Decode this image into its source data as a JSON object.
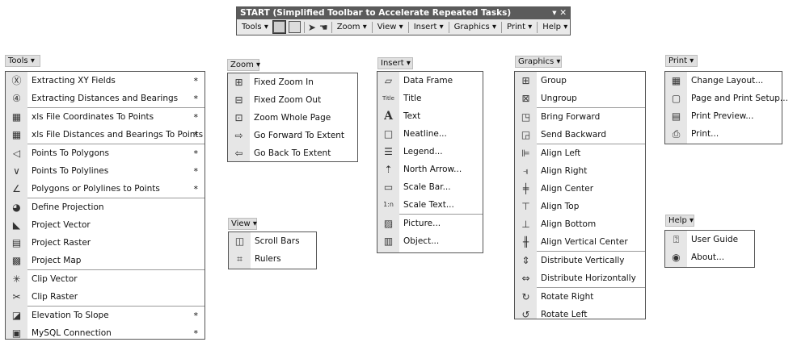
{
  "toolbar": {
    "title": "START (Simplified Toolbar to Accelerate Repeated Tasks)",
    "title_controls": "▾ ✕",
    "tools_label": "Tools",
    "zoom_label": "Zoom",
    "view_label": "View",
    "insert_label": "Insert",
    "graphics_label": "Graphics",
    "print_label": "Print",
    "help_label": "Help"
  },
  "tools_menu": {
    "header": "Tools",
    "items": [
      {
        "label": "Extracting  XY Fields",
        "star": "*",
        "icon": "xy-circle-icon"
      },
      {
        "label": "Extracting Distances and Bearings",
        "star": "*",
        "icon": "angle-45-icon"
      },
      {
        "label": "xls File Coordinates To Points",
        "star": "*",
        "icon": "xls-icon"
      },
      {
        "label": "xls File Distances and Bearings To Points",
        "star": "*",
        "icon": "xls-icon"
      },
      {
        "label": "Points To Polygons",
        "star": "*",
        "icon": "polygon-icon"
      },
      {
        "label": "Points To Polylines",
        "star": "*",
        "icon": "polyline-icon"
      },
      {
        "label": "Polygons or Polylines to Points",
        "star": "*",
        "icon": "points-icon"
      },
      {
        "label": "Define Projection",
        "star": "",
        "icon": "globe-icon"
      },
      {
        "label": "Project Vector",
        "star": "",
        "icon": "project-vector-icon"
      },
      {
        "label": "Project Raster",
        "star": "",
        "icon": "raster-grid-icon"
      },
      {
        "label": "Project Map",
        "star": "",
        "icon": "map-icon"
      },
      {
        "label": "Clip Vector",
        "star": "",
        "icon": "clip-vector-icon"
      },
      {
        "label": "Clip Raster",
        "star": "",
        "icon": "clip-raster-icon"
      },
      {
        "label": "Elevation To Slope",
        "star": "*",
        "icon": "slope-icon"
      },
      {
        "label": "MySQL Connection",
        "star": "*",
        "icon": "database-icon"
      }
    ]
  },
  "zoom_menu": {
    "header": "Zoom",
    "items": [
      {
        "label": "Fixed Zoom In",
        "icon": "zoom-in-icon"
      },
      {
        "label": "Fixed Zoom Out",
        "icon": "zoom-out-icon"
      },
      {
        "label": "Zoom Whole Page",
        "icon": "whole-page-icon"
      },
      {
        "label": "Go Forward To Extent",
        "icon": "forward-extent-icon"
      },
      {
        "label": "Go Back To Extent",
        "icon": "back-extent-icon"
      }
    ]
  },
  "view_menu": {
    "header": "View",
    "items": [
      {
        "label": "Scroll Bars",
        "icon": "scrollbars-icon"
      },
      {
        "label": "Rulers",
        "icon": "rulers-icon"
      }
    ]
  },
  "insert_menu": {
    "header": "Insert",
    "items": [
      {
        "label": "Data Frame",
        "icon": "data-frame-icon"
      },
      {
        "label": "Title",
        "icon": "title-icon"
      },
      {
        "label": "Text",
        "icon": "text-icon"
      },
      {
        "label": "Neatline...",
        "icon": "neatline-icon"
      },
      {
        "label": "Legend...",
        "icon": "legend-icon"
      },
      {
        "label": "North Arrow...",
        "icon": "north-arrow-icon"
      },
      {
        "label": "Scale Bar...",
        "icon": "scale-bar-icon"
      },
      {
        "label": "Scale Text...",
        "icon": "scale-text-icon"
      },
      {
        "label": "Picture...",
        "icon": "picture-icon"
      },
      {
        "label": "Object...",
        "icon": "object-icon"
      }
    ]
  },
  "graphics_menu": {
    "header": "Graphics",
    "items": [
      {
        "label": "Group",
        "icon": "group-icon"
      },
      {
        "label": "Ungroup",
        "icon": "ungroup-icon"
      },
      {
        "label": "Bring Forward",
        "icon": "bring-forward-icon"
      },
      {
        "label": "Send Backward",
        "icon": "send-backward-icon"
      },
      {
        "label": "Align Left",
        "icon": "align-left-icon"
      },
      {
        "label": "Align Right",
        "icon": "align-right-icon"
      },
      {
        "label": "Align Center",
        "icon": "align-center-icon"
      },
      {
        "label": "Align Top",
        "icon": "align-top-icon"
      },
      {
        "label": "Align Bottom",
        "icon": "align-bottom-icon"
      },
      {
        "label": "Align Vertical Center",
        "icon": "align-vcenter-icon"
      },
      {
        "label": "Distribute Vertically",
        "icon": "distribute-v-icon"
      },
      {
        "label": "Distribute Horizontally",
        "icon": "distribute-h-icon"
      },
      {
        "label": "Rotate Right",
        "icon": "rotate-right-icon"
      },
      {
        "label": "Rotate Left",
        "icon": "rotate-left-icon"
      }
    ]
  },
  "print_menu": {
    "header": "Print",
    "items": [
      {
        "label": "Change Layout...",
        "icon": "change-layout-icon"
      },
      {
        "label": "Page and Print Setup...",
        "icon": "page-setup-icon"
      },
      {
        "label": "Print Preview...",
        "icon": "print-preview-icon"
      },
      {
        "label": "Print...",
        "icon": "printer-icon"
      }
    ]
  },
  "help_menu": {
    "header": "Help",
    "items": [
      {
        "label": "User Guide",
        "icon": "help-icon"
      },
      {
        "label": "About...",
        "icon": "about-icon"
      }
    ]
  },
  "menu_caret": "▾"
}
